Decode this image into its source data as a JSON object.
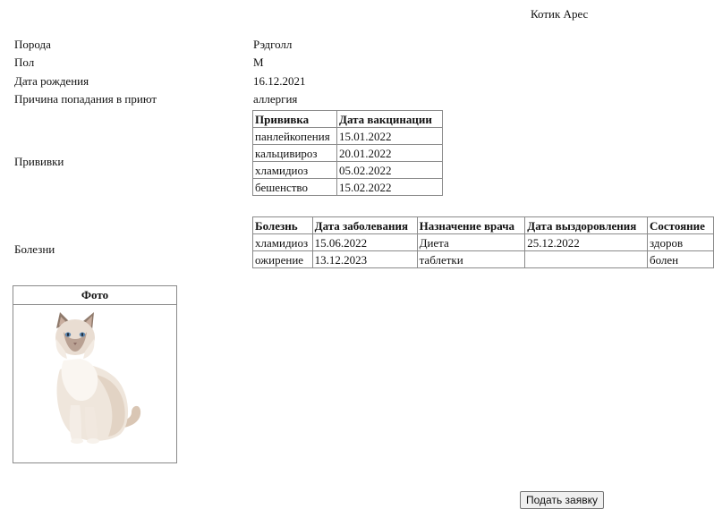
{
  "page": {
    "title": "Котик Арес"
  },
  "info": [
    {
      "label": "Порода",
      "value": "Рэдголл"
    },
    {
      "label": "Пол",
      "value": "М"
    },
    {
      "label": "Дата рождения",
      "value": "16.12.2021"
    },
    {
      "label": "Причина попадания в приют",
      "value": "аллергия"
    }
  ],
  "vaccinations": {
    "label": "Прививки",
    "headers": [
      "Прививка",
      "Дата вакцинации"
    ],
    "rows": [
      [
        "панлейкопения",
        "15.01.2022"
      ],
      [
        "кальцивироз",
        "20.01.2022"
      ],
      [
        "хламидиоз",
        "05.02.2022"
      ],
      [
        "бешенство",
        "15.02.2022"
      ]
    ]
  },
  "diseases": {
    "label": "Болезни",
    "headers": [
      "Болезнь",
      "Дата заболевания",
      "Назначение врача",
      "Дата выздоровления",
      "Состояние"
    ],
    "rows": [
      [
        "хламидиоз",
        "15.06.2022",
        "Диета",
        "25.12.2022",
        "здоров"
      ],
      [
        "ожирение",
        "13.12.2023",
        "таблетки",
        "",
        "болен"
      ]
    ]
  },
  "photo": {
    "header": "Фото",
    "icon": "cat-photo"
  },
  "actions": {
    "submit_label": "Подать заявку"
  }
}
